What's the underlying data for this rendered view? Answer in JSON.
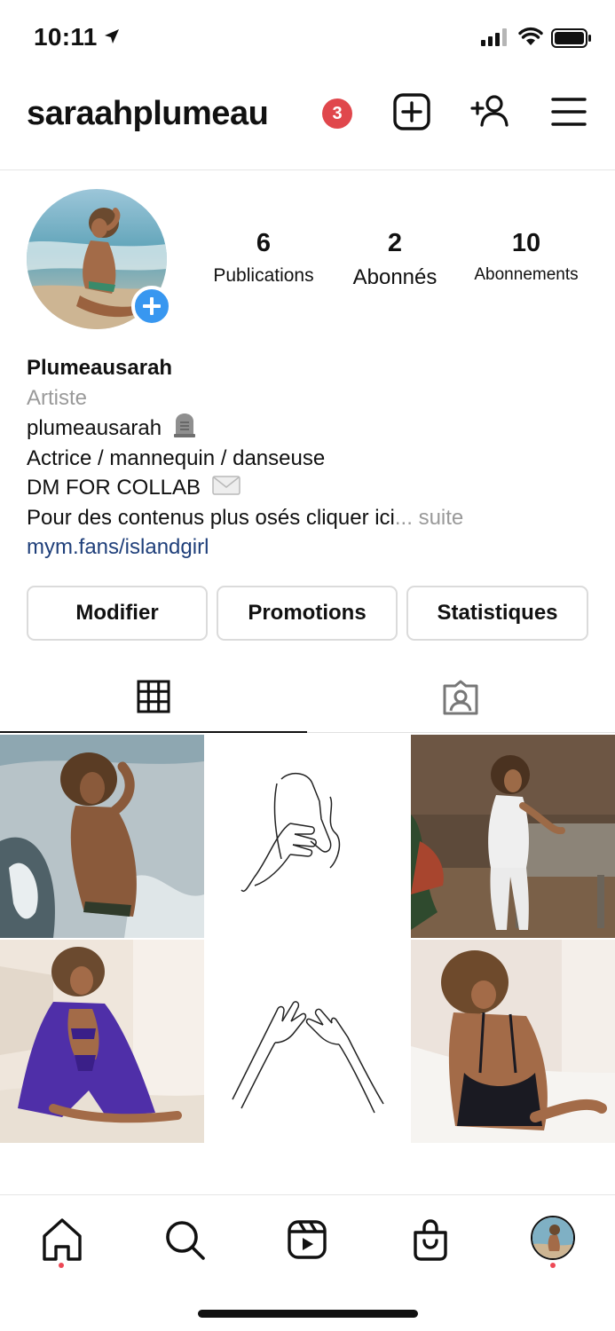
{
  "status_bar": {
    "time": "10:11",
    "icons": [
      "location-arrow-icon",
      "cellular-signal-icon",
      "wifi-icon",
      "battery-icon"
    ]
  },
  "header": {
    "username": "saraahplumeau",
    "notification_count": "3",
    "icons": [
      "new-post-icon",
      "add-user-icon",
      "menu-icon"
    ]
  },
  "profile": {
    "stats": [
      {
        "value": "6",
        "label": "Publications"
      },
      {
        "value": "2",
        "label": "Abonnés"
      },
      {
        "value": "10",
        "label": "Abonnements"
      }
    ],
    "bio": {
      "name": "Plumeausarah",
      "category": "Artiste",
      "lines": [
        "plumeausarah",
        "Actrice / mannequin / danseuse",
        "DM FOR COLLAB",
        "Pour des contenus plus osés cliquer ici"
      ],
      "more": "... suite",
      "link": "mym.fans/islandgirl"
    },
    "buttons": {
      "edit": "Modifier",
      "promotions": "Promotions",
      "stats": "Statistiques"
    }
  },
  "tabs": [
    {
      "icon": "grid-icon",
      "active": true
    },
    {
      "icon": "tagged-icon",
      "active": false
    }
  ],
  "posts": [
    {
      "kind": "photo",
      "subject": "beach-splash"
    },
    {
      "kind": "illustration",
      "subject": "hand-face-line-drawing"
    },
    {
      "kind": "photo",
      "subject": "woman-leaning-on-table"
    },
    {
      "kind": "photo",
      "subject": "purple-robe"
    },
    {
      "kind": "illustration",
      "subject": "hands-line-drawing"
    },
    {
      "kind": "photo",
      "subject": "black-bodysuit"
    }
  ],
  "bottom_nav": {
    "items": [
      "home-icon",
      "search-icon",
      "reels-icon",
      "shop-icon",
      "profile-avatar"
    ],
    "active": "profile-avatar"
  },
  "colors": {
    "badge": "#e0474c",
    "accent_blue": "#3897f0",
    "link": "#1f3f7a",
    "muted": "#9a9a9a",
    "nav_dot": "#ed4956"
  }
}
